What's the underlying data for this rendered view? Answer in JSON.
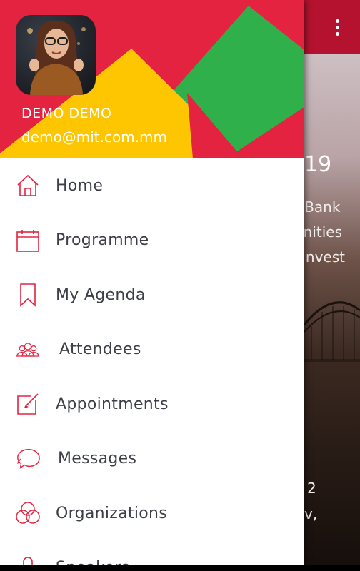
{
  "background": {
    "title_partial": "19",
    "lines": [
      "t Bank",
      "unities",
      "Invest"
    ],
    "lower_lines": [
      "2",
      "v,"
    ]
  },
  "drawer": {
    "user": {
      "name": "DEMO DEMO",
      "email": "demo@mit.com.mm"
    },
    "items": [
      {
        "label": "Home",
        "icon": "home-icon"
      },
      {
        "label": "Programme",
        "icon": "calendar-icon"
      },
      {
        "label": "My Agenda",
        "icon": "bookmark-icon"
      },
      {
        "label": "Attendees",
        "icon": "people-icon"
      },
      {
        "label": "Appointments",
        "icon": "edit-icon"
      },
      {
        "label": "Messages",
        "icon": "chat-icon"
      },
      {
        "label": "Organizations",
        "icon": "rings-icon"
      },
      {
        "label": "Speakers",
        "icon": "microphone-icon"
      }
    ]
  },
  "colors": {
    "accent": "#e32340",
    "toolbar": "#b5122f",
    "yellow": "#fdc600",
    "green": "#2fb04a",
    "text": "#3c3f47"
  }
}
